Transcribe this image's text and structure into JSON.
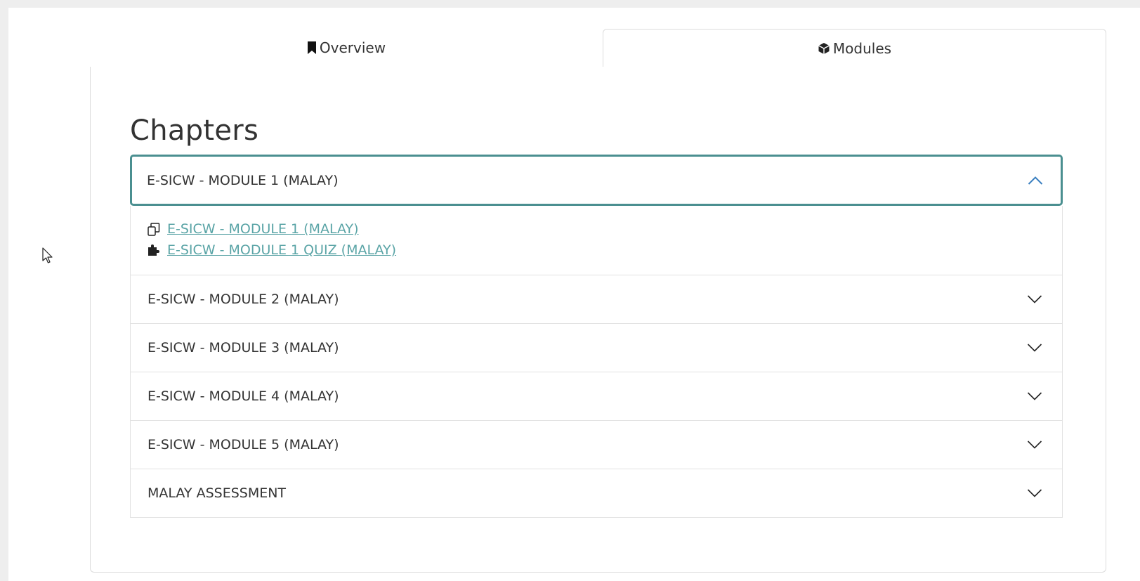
{
  "tabs": [
    {
      "label": "Overview",
      "icon": "bookmark-icon",
      "active": false
    },
    {
      "label": "Modules",
      "icon": "cube-icon",
      "active": true
    }
  ],
  "chapters": {
    "title": "Chapters",
    "accent_color": "#4a8f90",
    "link_color": "#5aa4a6",
    "items": [
      {
        "label": "E-SICW - MODULE 1 (MALAY)",
        "expanded": true,
        "links": [
          {
            "label": "E-SICW - MODULE 1 (MALAY)",
            "icon": "copy-pages-icon"
          },
          {
            "label": "E-SICW - MODULE 1 QUIZ (MALAY)",
            "icon": "puzzle-icon"
          }
        ]
      },
      {
        "label": "E-SICW - MODULE 2 (MALAY)",
        "expanded": false
      },
      {
        "label": "E-SICW - MODULE 3 (MALAY)",
        "expanded": false
      },
      {
        "label": "E-SICW - MODULE 4 (MALAY)",
        "expanded": false
      },
      {
        "label": "E-SICW - MODULE 5 (MALAY)",
        "expanded": false
      },
      {
        "label": "MALAY ASSESSMENT",
        "expanded": false
      }
    ]
  }
}
